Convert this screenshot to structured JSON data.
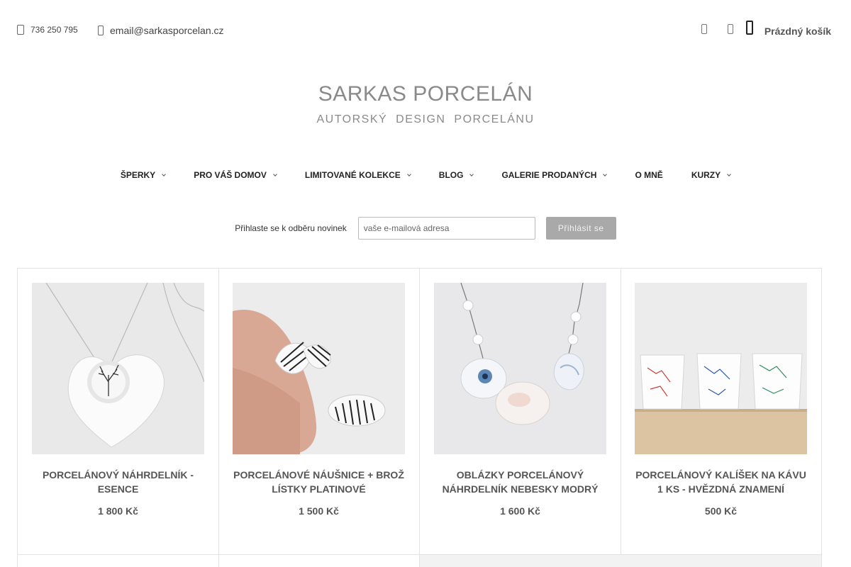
{
  "header": {
    "phone": "736 250 795",
    "email": "email@sarkasporcelan.cz",
    "cart_label": "Prázdný košík",
    "icons": [
      "user-icon",
      "search-icon",
      "cart-icon"
    ]
  },
  "logo": {
    "title": "SARKAS PORCELÁN",
    "subtitle": "AUTORSKÝ DESIGN PORCELÁNU"
  },
  "nav": {
    "items": [
      {
        "label": "ŠPERKY",
        "has_dropdown": true
      },
      {
        "label": "PRO VÁŠ DOMOV",
        "has_dropdown": true
      },
      {
        "label": "LIMITOVANÉ KOLEKCE",
        "has_dropdown": true
      },
      {
        "label": "BLOG",
        "has_dropdown": true
      },
      {
        "label": "GALERIE PRODANÝCH",
        "has_dropdown": true
      },
      {
        "label": "O MNĚ",
        "has_dropdown": false
      },
      {
        "label": "KURZY",
        "has_dropdown": true
      }
    ]
  },
  "newsletter": {
    "label": "Přihlaste se k odběru novinek",
    "placeholder": "vaše e-mailová adresa",
    "button": "Přihlásit se"
  },
  "products": [
    {
      "name": "PORCELÁNOVÝ NÁHRDELNÍK - ESENCE",
      "price": "1 800 Kč"
    },
    {
      "name": "PORCELÁNOVÉ NÁUŠNICE + BROŽ LÍSTKY PLATINOVÉ",
      "price": "1 500 Kč"
    },
    {
      "name": "OBLÁZKY PORCELÁNOVÝ NÁHRDELNÍK NEBESKY MODRÝ",
      "price": "1 600 Kč"
    },
    {
      "name": "PORCELÁNOVÝ KALÍŠEK NA KÁVU 1 KS - HVĚZDNÁ ZNAMENÍ",
      "price": "500 Kč"
    }
  ],
  "colors": {
    "button_bg": "#a9a9a9",
    "logo_text": "#8a8a8a",
    "border": "#e3e3e3"
  }
}
